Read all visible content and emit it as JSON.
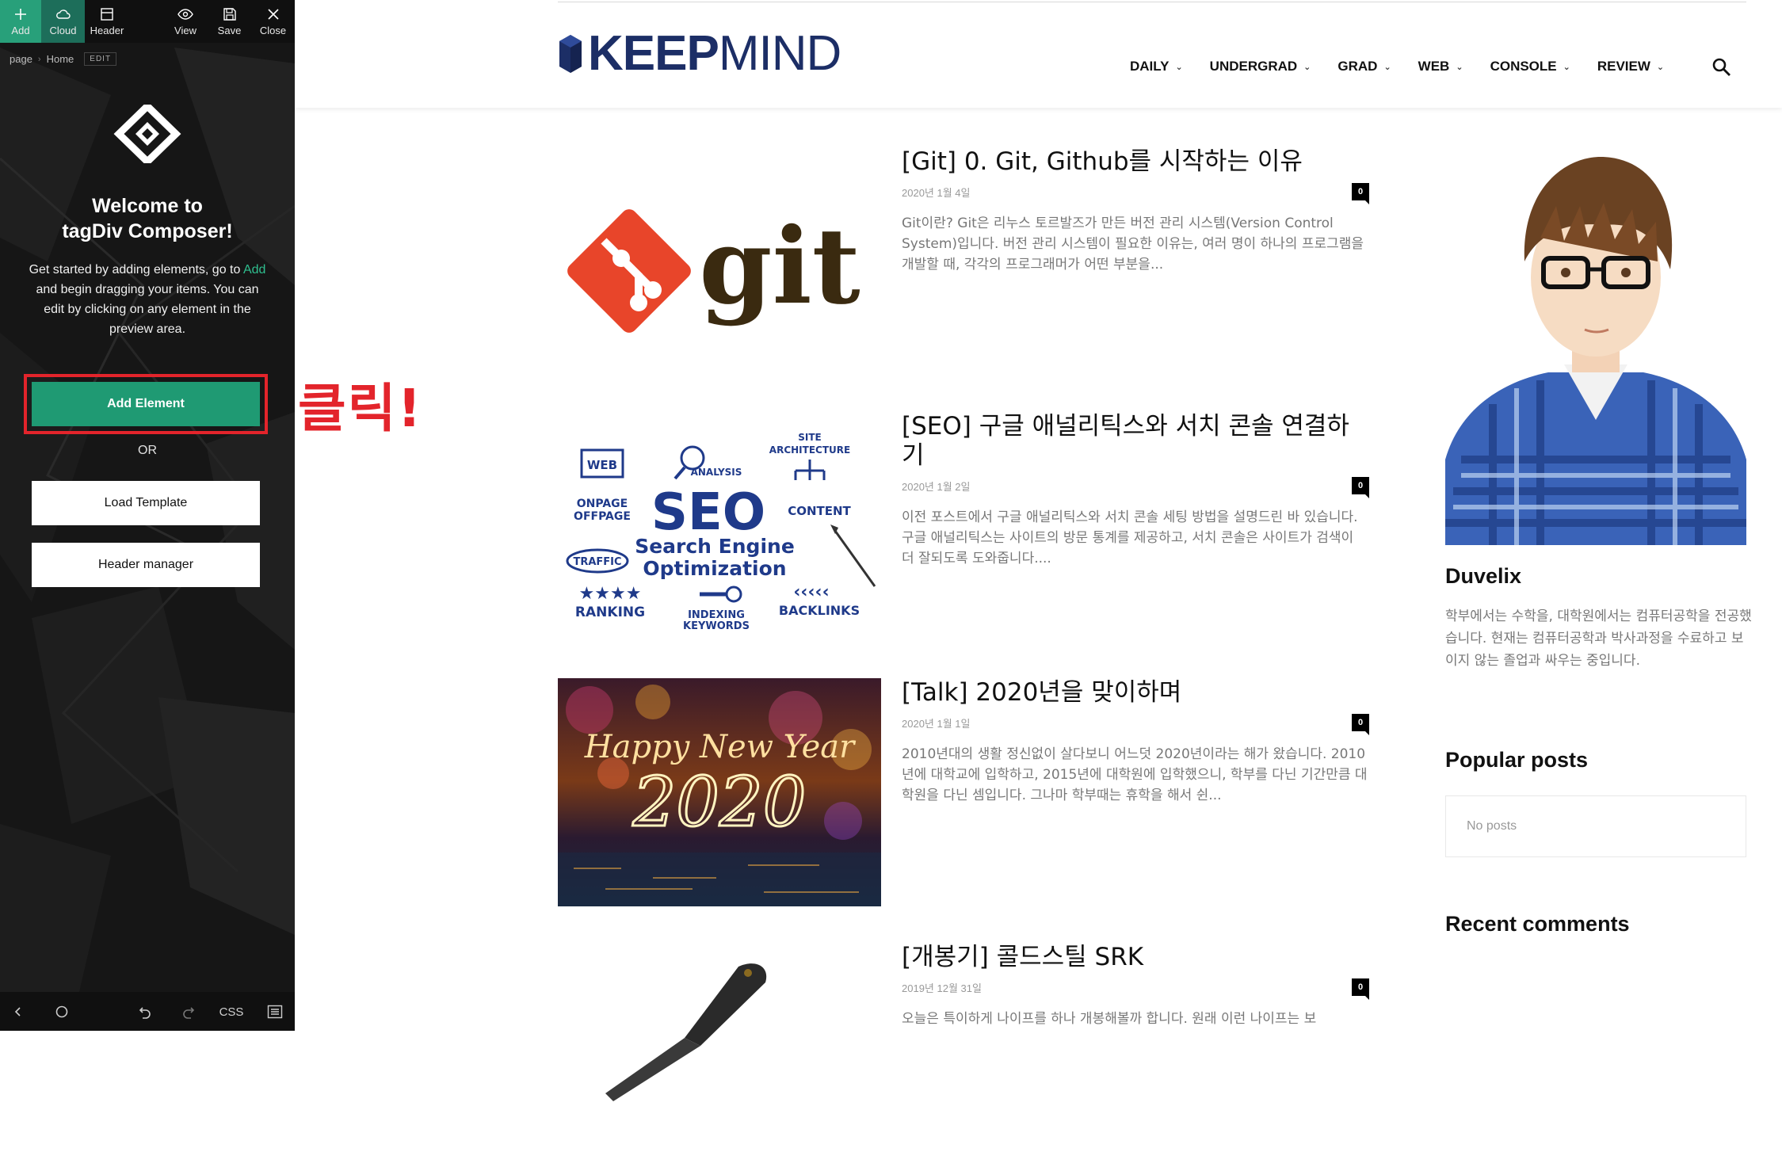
{
  "composer": {
    "topbar": {
      "add_label": "Add",
      "cloud_label": "Cloud",
      "header_label": "Header",
      "view_label": "View",
      "save_label": "Save",
      "close_label": "Close"
    },
    "breadcrumb": {
      "page": "page",
      "home": "Home",
      "edit": "EDIT"
    },
    "welcome_line1": "Welcome to",
    "welcome_line2": "tagDiv Composer!",
    "intro_part1": "Get started by adding elements, go to",
    "intro_add": "Add",
    "intro_part2": "and begin dragging your items. You can edit by clicking on any element in the preview area.",
    "add_element_label": "Add Element",
    "or_label": "OR",
    "load_template_label": "Load Template",
    "header_manager_label": "Header manager",
    "bottombar": {
      "css_label": "CSS"
    }
  },
  "annotation": "클릭!",
  "site": {
    "logo_bold": "KEEP",
    "logo_light": "MIND",
    "nav": [
      {
        "label": "DAILY"
      },
      {
        "label": "UNDERGRAD"
      },
      {
        "label": "GRAD"
      },
      {
        "label": "WEB"
      },
      {
        "label": "CONSOLE"
      },
      {
        "label": "REVIEW"
      }
    ],
    "posts": [
      {
        "title": "[Git] 0. Git, Github를 시작하는 이유",
        "date": "2020년 1월 4일",
        "comments": "0",
        "excerpt": "Git이란? Git은 리누스 토르발즈가 만든 버전 관리 시스템(Version Control System)입니다. 버전 관리 시스템이 필요한 이유는, 여러 명이 하나의 프로그램을 개발할 때, 각각의 프로그래머가 어떤 부분을..."
      },
      {
        "title": "[SEO] 구글 애널리틱스와 서치 콘솔 연결하기",
        "date": "2020년 1월 2일",
        "comments": "0",
        "excerpt": "이전 포스트에서 구글 애널리틱스와 서치 콘솔 세팅 방법을 설명드린 바 있습니다. 구글 애널리틱스는 사이트의 방문 통계를 제공하고, 서치 콘솔은 사이트가 검색이 더 잘되도록 도와줍니다...."
      },
      {
        "title": "[Talk] 2020년을 맞이하며",
        "date": "2020년 1월 1일",
        "comments": "0",
        "excerpt": "2010년대의 생활 정신없이 살다보니 어느덧 2020년이라는 해가 왔습니다. 2010년에 대학교에 입학하고, 2015년에 대학원에 입학했으니, 학부를 다닌 기간만큼 대학원을 다닌 셈입니다. 그나마 학부때는 휴학을 해서 쉰..."
      },
      {
        "title": "[개봉기] 콜드스틸 SRK",
        "date": "2019년 12월 31일",
        "comments": "0",
        "excerpt": "오늘은 특이하게 나이프를 하나 개봉해볼까 합니다. 원래 이런 나이프는 보"
      }
    ],
    "thumb_texts": {
      "git": "git",
      "seo_main": "SEO",
      "seo_sub1": "Search Engine",
      "seo_sub2": "Optimization",
      "seo_web": "WEB",
      "seo_analysis": "ANALYSIS",
      "seo_site": "SITE",
      "seo_arch": "ARCHITECTURE",
      "seo_onpage": "ONPAGE",
      "seo_offpage": "OFFPAGE",
      "seo_content": "CONTENT",
      "seo_traffic": "TRAFFIC",
      "seo_ranking": "RANKING",
      "seo_indexing": "INDEXING",
      "seo_keywords": "KEYWORDS",
      "seo_backlinks": "BACKLINKS",
      "ny_line1": "Happy New Year",
      "ny_line2": "2020"
    },
    "sidebar": {
      "author_name": "Duvelix",
      "author_bio": "학부에서는 수학을, 대학원에서는 컴퓨터공학을 전공했습니다. 현재는 컴퓨터공학과 박사과정을 수료하고 보이지 않는 졸업과 싸우는 중입니다.",
      "popular_title": "Popular posts",
      "no_posts": "No posts",
      "recent_title": "Recent comments"
    }
  }
}
